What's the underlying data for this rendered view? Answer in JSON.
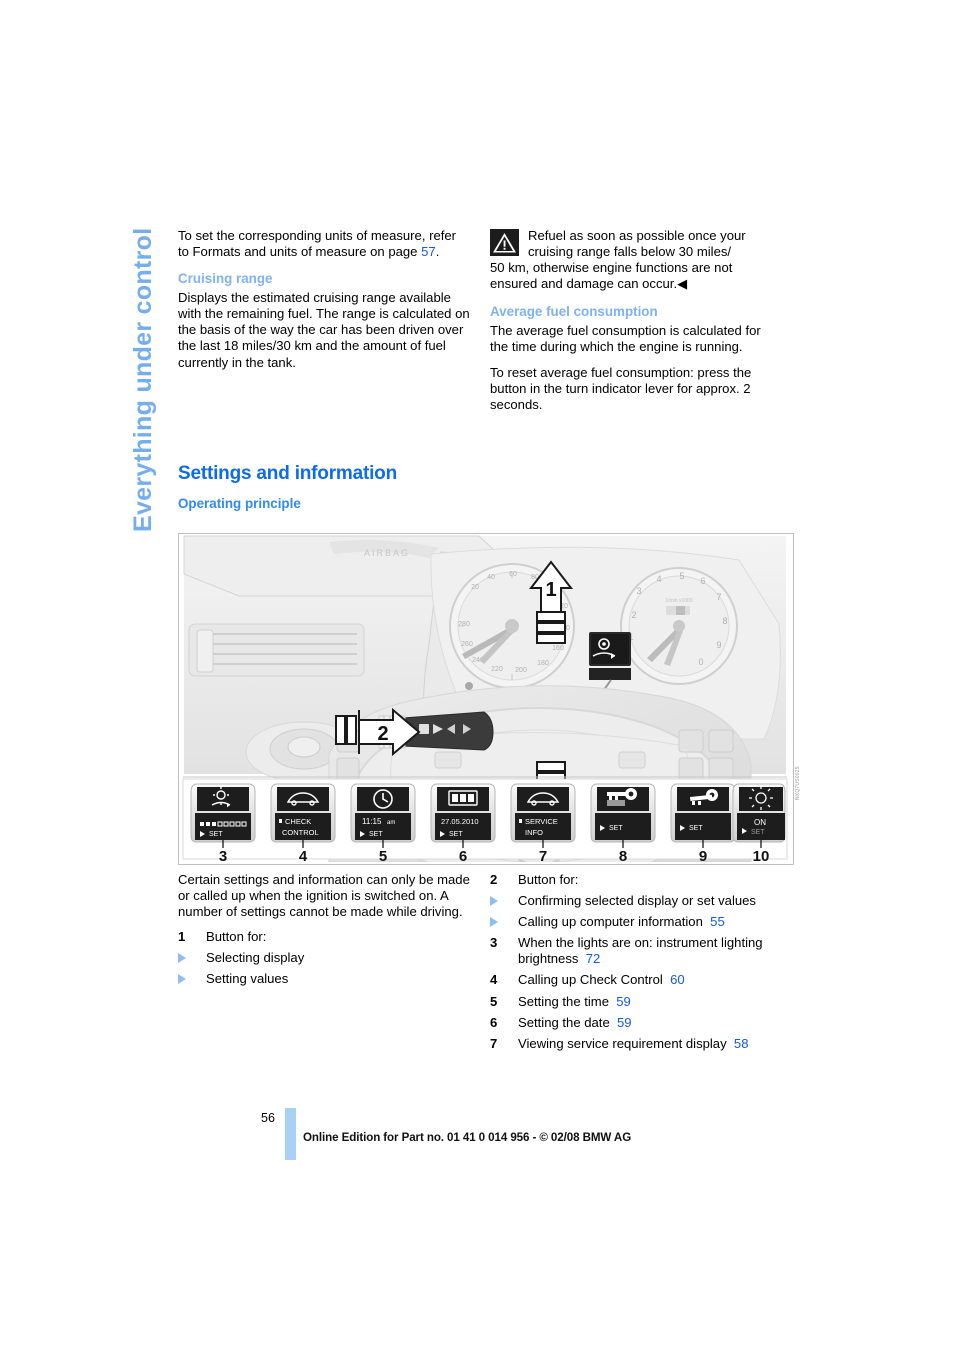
{
  "chapter_tab": "Everything under control",
  "left_column": {
    "intro_paragraph_part1": "To set the corresponding units of measure, refer to Formats and units of measure on page ",
    "intro_page_ref": "57",
    "intro_paragraph_part2": ".",
    "cruising_range_heading": "Cruising range",
    "cruising_range_body": "Displays the estimated cruising range available with the remaining fuel. The range is calculated on the basis of the way the car has been driven over the last 18 miles/30 km and the amount of fuel currently in the tank."
  },
  "right_column": {
    "warning_icon": "warning-triangle-icon",
    "warning_line1": "Refuel as soon as possible once your",
    "warning_line2": "cruising range falls below 30 miles/",
    "warning_rest": "50 km, otherwise engine functions are not ensured and damage can occur.",
    "warning_end_mark": "◀",
    "avg_fuel_heading": "Average fuel consumption",
    "avg_fuel_body1": "The average fuel consumption is calculated for the time during which the engine is running.",
    "avg_fuel_body2": "To reset average fuel consumption: press the button in the turn indicator lever for approx. 2 seconds."
  },
  "section": {
    "title": "Settings and information",
    "subtitle": "Operating principle"
  },
  "figure": {
    "credit": "NXQ7US0025",
    "callouts": {
      "lever_up": "1",
      "lever_press": "2",
      "lever_down": "1"
    },
    "display_buttons": [
      {
        "number": "3",
        "icon": "brightness-icon",
        "screen_line1": "■■■□□□□□",
        "screen_line2": "SET"
      },
      {
        "number": "4",
        "icon": "car-check-icon",
        "screen_line1": "CHECK",
        "screen_line2": "CONTROL"
      },
      {
        "number": "5",
        "icon": "clock-icon",
        "screen_line1": "11:15 am",
        "screen_line2": "SET"
      },
      {
        "number": "6",
        "icon": "calendar-icon",
        "screen_line1": "27.05.2010",
        "screen_line2": "SET"
      },
      {
        "number": "7",
        "icon": "car-service-icon",
        "screen_line1": "SERVICE",
        "screen_line2": "INFO"
      },
      {
        "number": "8",
        "icon": "key-memory-icon",
        "screen_line1": "",
        "screen_line2": "SET"
      },
      {
        "number": "9",
        "icon": "key-icon",
        "screen_line1": "",
        "screen_line2": "SET"
      },
      {
        "number": "10",
        "icon": "alarm-icon",
        "screen_line1": "ON",
        "screen_line2": "SET"
      }
    ]
  },
  "lower_left": {
    "paragraph": "Certain settings and information can only be made or called up when the ignition is switched on. A number of settings cannot be made while driving.",
    "item1": {
      "number": "1",
      "label": "Button for:",
      "sub": [
        {
          "text": "Selecting display",
          "ref": ""
        },
        {
          "text": "Setting values",
          "ref": ""
        }
      ]
    }
  },
  "lower_right": {
    "item2": {
      "number": "2",
      "label": "Button for:",
      "sub": [
        {
          "text": "Confirming selected display or set values",
          "ref": ""
        },
        {
          "text": "Calling up computer information",
          "ref": "55"
        }
      ]
    },
    "items": [
      {
        "number": "3",
        "text": "When the lights are on: instrument lighting brightness",
        "ref": "72"
      },
      {
        "number": "4",
        "text": "Calling up Check Control",
        "ref": "60"
      },
      {
        "number": "5",
        "text": "Setting the time",
        "ref": "59"
      },
      {
        "number": "6",
        "text": "Setting the date",
        "ref": "59"
      },
      {
        "number": "7",
        "text": "Viewing service requirement display",
        "ref": "58"
      }
    ]
  },
  "footer": {
    "page_number": "56",
    "text": "Online Edition for Part no. 01 41 0 014 956 - © 02/08 BMW AG"
  },
  "colors": {
    "heading_blue": "#0C6BEF",
    "subheading_blue": "#7FB2F0",
    "link_blue": "#1358E8",
    "tab_blue": "#74AEEF",
    "footer_bar": "#A9D0F5"
  }
}
